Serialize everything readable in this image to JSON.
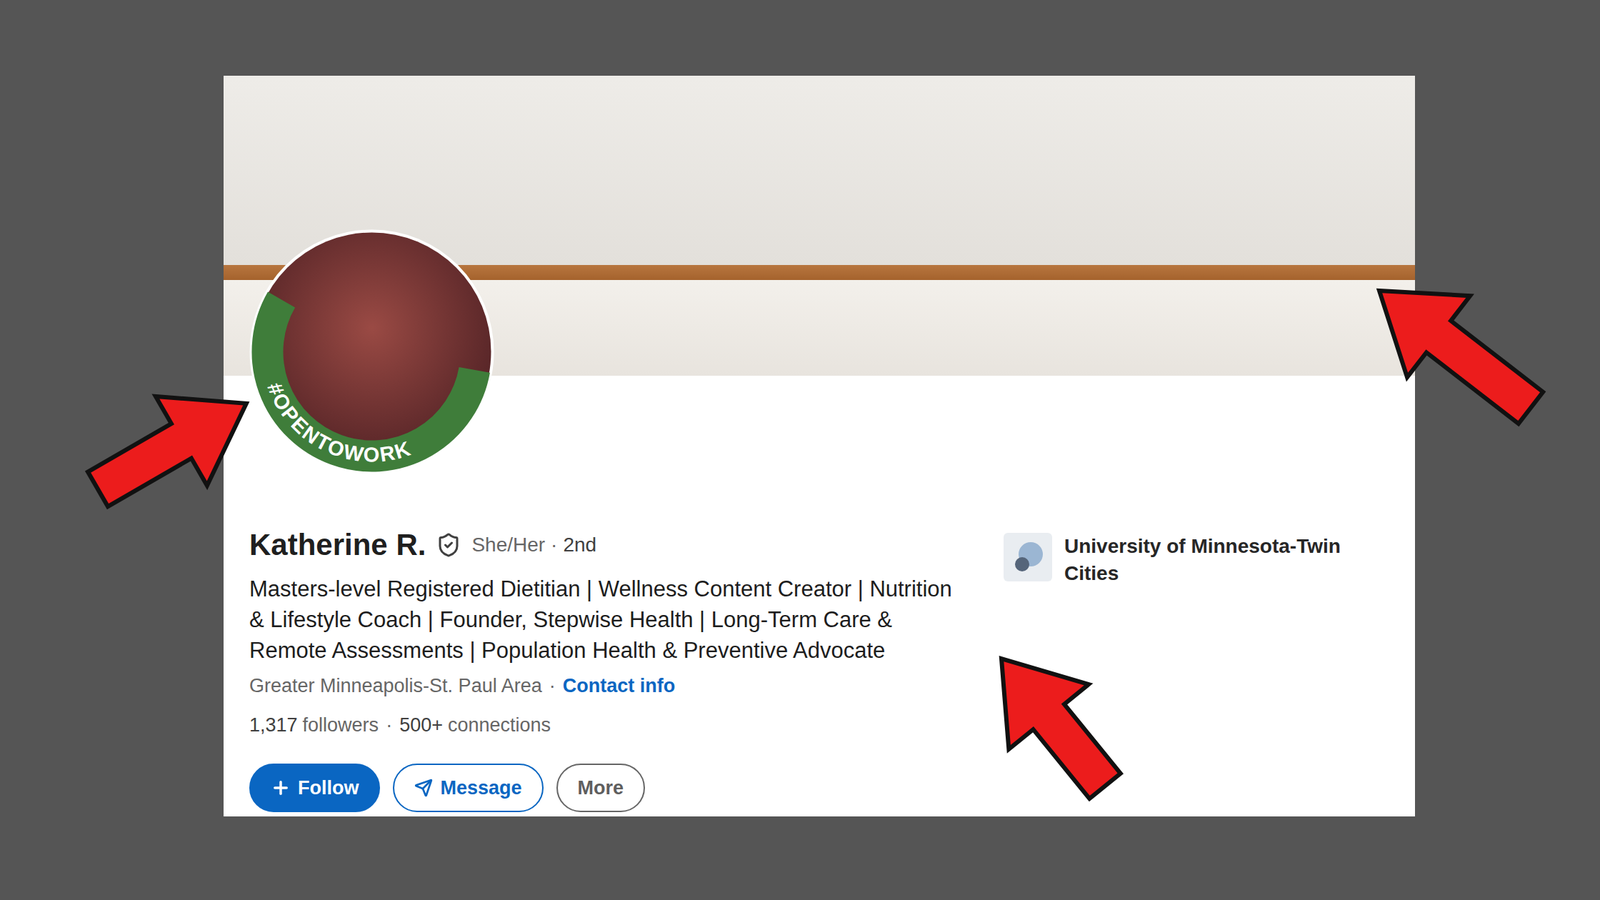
{
  "profile": {
    "name": "Katherine R.",
    "verified": true,
    "pronouns": "She/Her",
    "separator": "·",
    "degree": "2nd",
    "open_to_work": true,
    "frame_label": "#OPENTOWORK",
    "headline": "Masters-level Registered Dietitian | Wellness Content Creator | Nutrition & Lifestyle Coach | Founder, Stepwise Health | Long-Term Care & Remote Assessments | Population Health & Preventive Advocate",
    "location": "Greater Minneapolis-St. Paul Area",
    "contact_link": "Contact info"
  },
  "stats": {
    "followers": {
      "count": "1,317",
      "label": "followers"
    },
    "connections": {
      "count": "500+",
      "label": "connections"
    }
  },
  "buttons": [
    {
      "label": "Follow",
      "kind": "primary"
    },
    {
      "label": "Message",
      "kind": "secondary"
    },
    {
      "label": "More",
      "kind": "muted"
    }
  ],
  "education": {
    "school": "University of Minnesota-Twin Cities"
  }
}
